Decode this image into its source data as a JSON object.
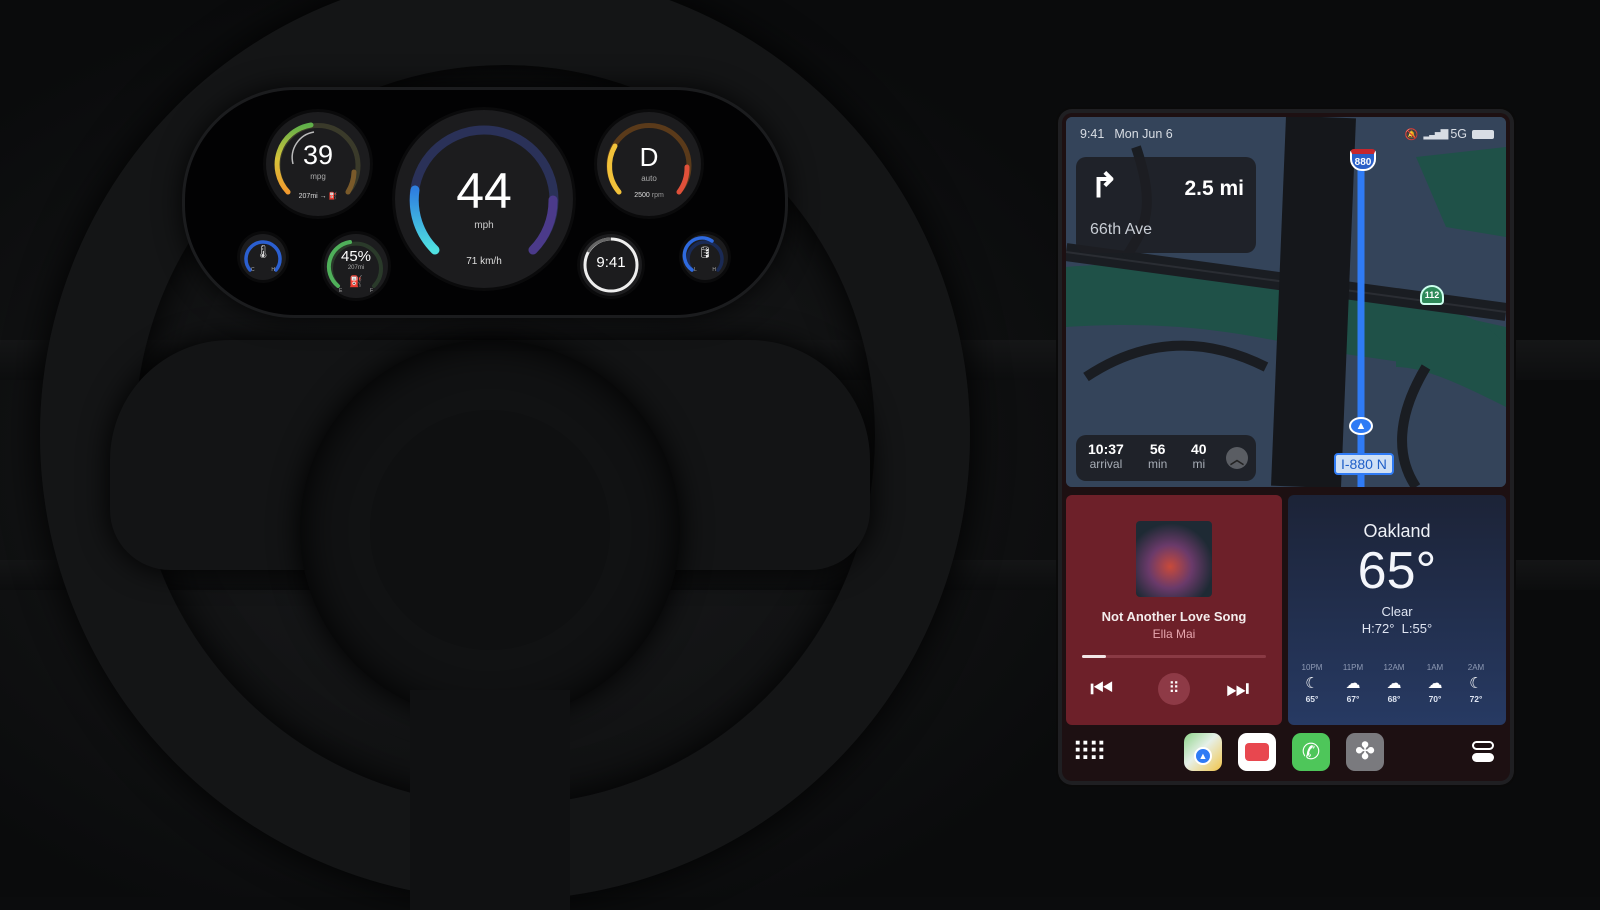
{
  "cluster": {
    "fuel_economy": {
      "value": "39",
      "unit": "mpg",
      "range": "207mi",
      "range_arrow": "→"
    },
    "speed": {
      "value": "44",
      "unit": "mph",
      "secondary": "71 km/h"
    },
    "gear": {
      "value": "D",
      "mode": "auto",
      "rpm_value": "2500",
      "rpm_unit": "rpm"
    },
    "coolant": {
      "low_label": "C",
      "high_label": "H",
      "level": 0.55
    },
    "fuel": {
      "percent": "45%",
      "range": "207mi",
      "low_label": "E",
      "high_label": "F",
      "level": 0.45
    },
    "clock": {
      "time": "9:41"
    },
    "oil": {
      "low_label": "L",
      "high_label": "H",
      "level": 0.6
    }
  },
  "carplay": {
    "status_bar": {
      "time": "9:41",
      "date": "Mon Jun 6",
      "network": "5G"
    },
    "navigation": {
      "maneuver_distance": "2.5 mi",
      "street": "66th Ave",
      "eta": {
        "arrival_time": "10:37",
        "arrival_label": "arrival",
        "duration": "56",
        "duration_label": "min",
        "distance": "40",
        "distance_label": "mi"
      },
      "highway_shield": "880",
      "route_shield": "112",
      "current_road": "I-880 N"
    },
    "now_playing": {
      "title": "Not Another Love Song",
      "artist": "Ella Mai",
      "progress": 0.13
    },
    "weather": {
      "city": "Oakland",
      "temperature": "65°",
      "condition": "Clear",
      "high_low": "H:72°  L:55°",
      "hourly": [
        {
          "time": "10PM",
          "icon": "moon-stars",
          "temp": "65°"
        },
        {
          "time": "11PM",
          "icon": "cloud-moon-rain",
          "temp": "67°"
        },
        {
          "time": "12AM",
          "icon": "cloud-rain",
          "temp": "68°"
        },
        {
          "time": "1AM",
          "icon": "cloud-moon",
          "temp": "70°"
        },
        {
          "time": "2AM",
          "icon": "moon",
          "temp": "72°"
        }
      ]
    },
    "dock": {
      "apps": [
        "Maps",
        "Radio",
        "Phone",
        "Climate"
      ]
    }
  }
}
